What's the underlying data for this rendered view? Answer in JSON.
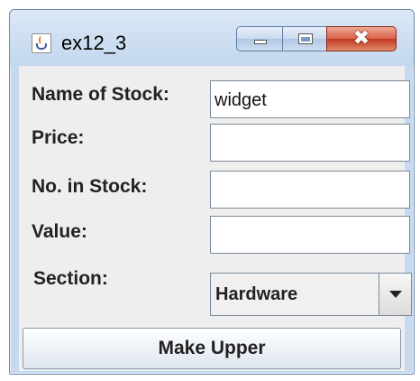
{
  "window": {
    "title": "ex12_3",
    "icon": "java-cup-icon",
    "controls": {
      "minimize": "minimize-icon",
      "maximize": "maximize-icon",
      "close_glyph": "✖"
    }
  },
  "form": {
    "name_label": "Name of Stock:",
    "name_value": "widget",
    "price_label": "Price:",
    "price_value": "",
    "stock_label": "No. in Stock:",
    "stock_value": "",
    "value_label": "Value:",
    "value_value": "",
    "section_label": "Section:",
    "section_selected": "Hardware"
  },
  "action": {
    "label": "Make Upper"
  },
  "colors": {
    "frame": "#c6d9ef",
    "client": "#eeeeee",
    "close": "#c2381f"
  }
}
